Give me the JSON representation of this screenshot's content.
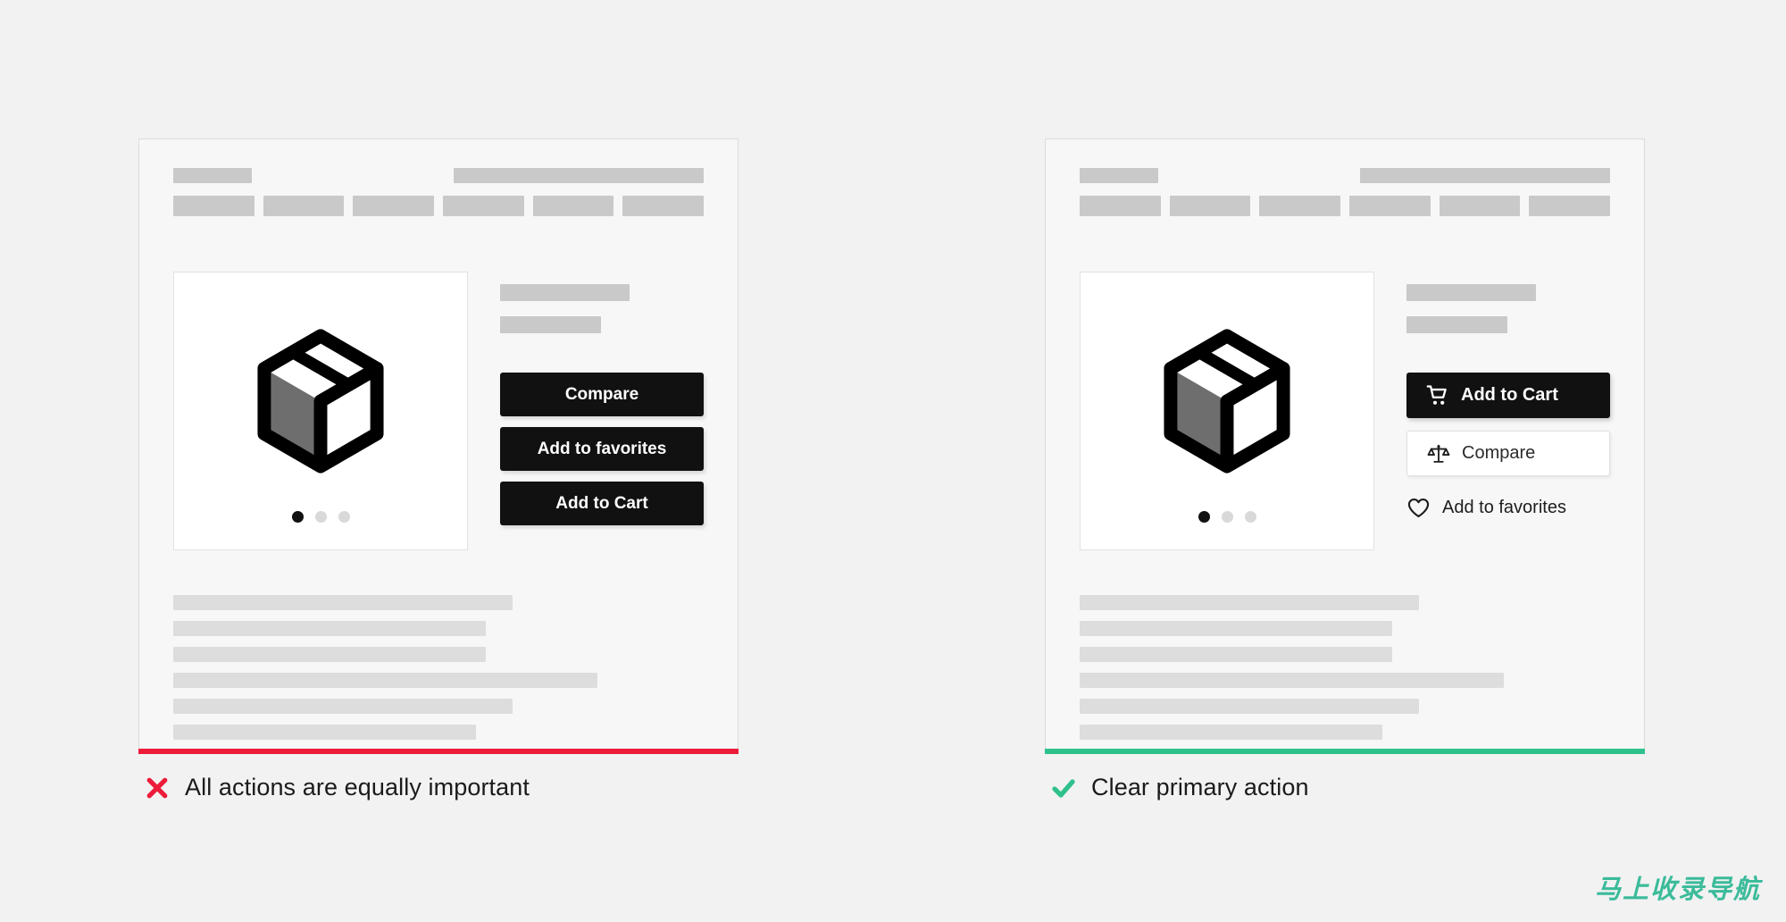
{
  "meta": {
    "background_color": "#f2f2f2",
    "card_background": "#f7f7f7",
    "card_border": "#dcdcdc",
    "skeleton_gray": "#c9c9c9",
    "text_skeleton_gray": "#dddddd",
    "black": "#111111",
    "error_color": "#ED1C3B",
    "success_color": "#2FC18C",
    "watermark_color": "#3bbb9a"
  },
  "examples": [
    {
      "id": "dont",
      "accent_color": "#ED1C3B",
      "caption": {
        "mark": "cross-icon",
        "text": "All actions are equally important"
      },
      "header": {
        "logo_bar": "",
        "search_bar": "",
        "nav_items": [
          "",
          "",
          "",
          "",
          "",
          ""
        ]
      },
      "gallery": {
        "product_icon": "box-package-icon",
        "dots": [
          {
            "label": "slide-1",
            "active": true
          },
          {
            "label": "slide-2",
            "active": false
          },
          {
            "label": "slide-3",
            "active": false
          }
        ]
      },
      "product_info": {
        "title_bar": "",
        "subtitle_bar": ""
      },
      "actions": [
        {
          "label": "Compare",
          "style": "solid",
          "icon": null
        },
        {
          "label": "Add to favorites",
          "style": "solid",
          "icon": null
        },
        {
          "label": "Add to Cart",
          "style": "solid",
          "icon": null
        }
      ],
      "body_lines": [
        64,
        59,
        59,
        80,
        64,
        57
      ]
    },
    {
      "id": "do",
      "accent_color": "#2FC18C",
      "caption": {
        "mark": "check-icon",
        "text": "Clear primary action"
      },
      "header": {
        "logo_bar": "",
        "search_bar": "",
        "nav_items": [
          "",
          "",
          "",
          "",
          "",
          ""
        ]
      },
      "gallery": {
        "product_icon": "box-package-icon",
        "dots": [
          {
            "label": "slide-1",
            "active": true
          },
          {
            "label": "slide-2",
            "active": false
          },
          {
            "label": "slide-3",
            "active": false
          }
        ]
      },
      "product_info": {
        "title_bar": "",
        "subtitle_bar": ""
      },
      "actions": [
        {
          "label": "Add to Cart",
          "style": "primary",
          "icon": "shopping-cart-icon"
        },
        {
          "label": "Compare",
          "style": "secondary",
          "icon": "scales-balance-icon"
        },
        {
          "label": "Add to favorites",
          "style": "tertiary",
          "icon": "heart-outline-icon"
        }
      ],
      "body_lines": [
        64,
        59,
        59,
        80,
        64,
        57
      ]
    }
  ],
  "watermark": {
    "text": "马上收录导航"
  }
}
